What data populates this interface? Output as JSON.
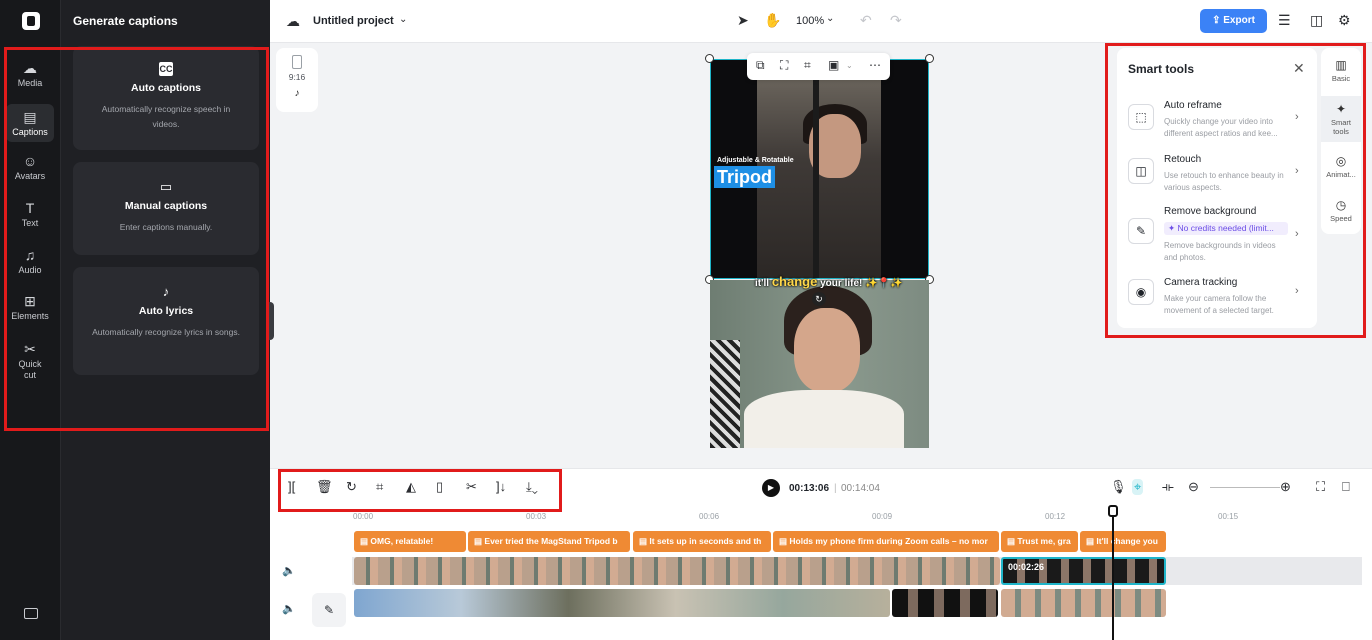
{
  "rail": {
    "items": [
      {
        "label": "Media",
        "icon": "cloud-icon",
        "glyph": "☁"
      },
      {
        "label": "Captions",
        "icon": "captions-icon",
        "glyph": "▤"
      },
      {
        "label": "Avatars",
        "icon": "avatar-icon",
        "glyph": "☺"
      },
      {
        "label": "Text",
        "icon": "text-icon",
        "glyph": "T"
      },
      {
        "label": "Audio",
        "icon": "music-icon",
        "glyph": "♫"
      },
      {
        "label": "Elements",
        "icon": "elements-icon",
        "glyph": "⊞"
      },
      {
        "label": "Quick cut",
        "icon": "quick-cut-icon",
        "glyph": "✂"
      }
    ]
  },
  "panel": {
    "title": "Generate captions",
    "cards": [
      {
        "title": "Auto captions",
        "desc": "Automatically recognize speech in videos.",
        "glyph": "CC"
      },
      {
        "title": "Manual captions",
        "desc": "Enter captions manually.",
        "glyph": "▭"
      },
      {
        "title": "Auto lyrics",
        "desc": "Automatically recognize lyrics in songs.",
        "glyph": "♪"
      }
    ]
  },
  "topbar": {
    "project_name": "Untitled project",
    "zoom": "100%",
    "export_label": "Export"
  },
  "ratio": {
    "label": "9:16"
  },
  "canvas": {
    "small_caption": "Adjustable & Rotatable",
    "big_caption": "Tripod",
    "subtitle_pre": "it'll ",
    "subtitle_hl": "change",
    "subtitle_post": " your life! ✨📍✨"
  },
  "smart_tools": {
    "title": "Smart tools",
    "items": [
      {
        "title": "Auto reframe",
        "desc": "Quickly change your video into different aspect ratios and kee...",
        "glyph": "⬚"
      },
      {
        "title": "Retouch",
        "desc": "Use retouch to enhance beauty in various aspects.",
        "glyph": "◫"
      },
      {
        "title": "Remove background",
        "credit": "✦ No credits needed (limit...",
        "desc": "Remove backgrounds in videos and photos.",
        "glyph": "✎"
      },
      {
        "title": "Camera tracking",
        "desc": "Make your camera follow the movement of a selected target.",
        "glyph": "◉"
      }
    ]
  },
  "right_rail": {
    "items": [
      {
        "label": "Basic",
        "glyph": "▥"
      },
      {
        "label": "Smart tools",
        "glyph": "✦"
      },
      {
        "label": "Animat...",
        "glyph": "◎"
      },
      {
        "label": "Speed",
        "glyph": "◷"
      }
    ]
  },
  "timeline": {
    "current_time": "00:13:06",
    "total_time": "00:14:04",
    "ruler": [
      "00:00",
      "00:03",
      "00:06",
      "00:09",
      "00:12",
      "00:15"
    ],
    "caption_clips": [
      "OMG, relatable!",
      "Ever tried the MagStand Tripod b",
      "It sets up in seconds and th",
      "Holds my phone firm during Zoom calls – no mor",
      "Trust me, gra",
      "It'll change you"
    ],
    "clip_duration": "00:02:26"
  }
}
